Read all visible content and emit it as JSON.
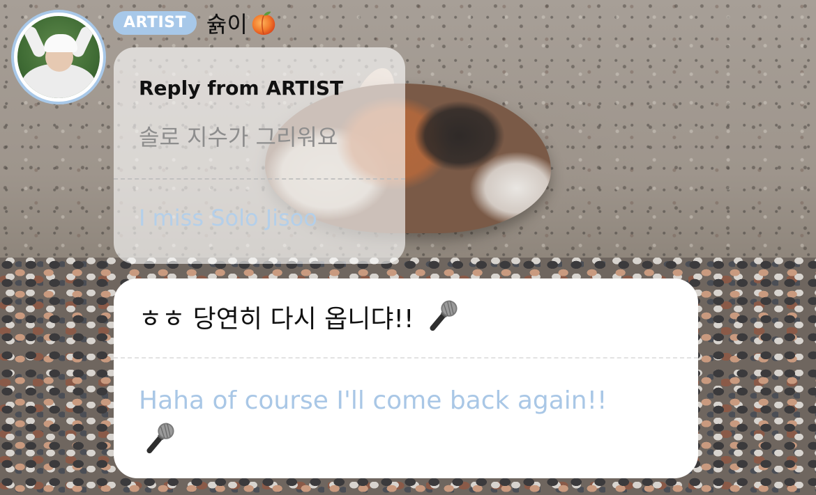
{
  "header": {
    "badge_label": "ARTIST",
    "artist_name": "슑이",
    "name_emoji": "peach-icon"
  },
  "reply": {
    "title": "Reply from ARTIST",
    "quoted_message": "솔로 지수가 그리워요",
    "quoted_translation": "I miss Solo Jisoo"
  },
  "message": {
    "text": "ㅎㅎ 당연히 다시 옵니댜!!",
    "translation": "Haha of course I'll come back again!!",
    "emoji": "microphone-icon"
  },
  "colors": {
    "badge_bg": "#a7c8e9",
    "translation_text": "#a9c7e6",
    "avatar_ring": "#a8c8e8"
  }
}
